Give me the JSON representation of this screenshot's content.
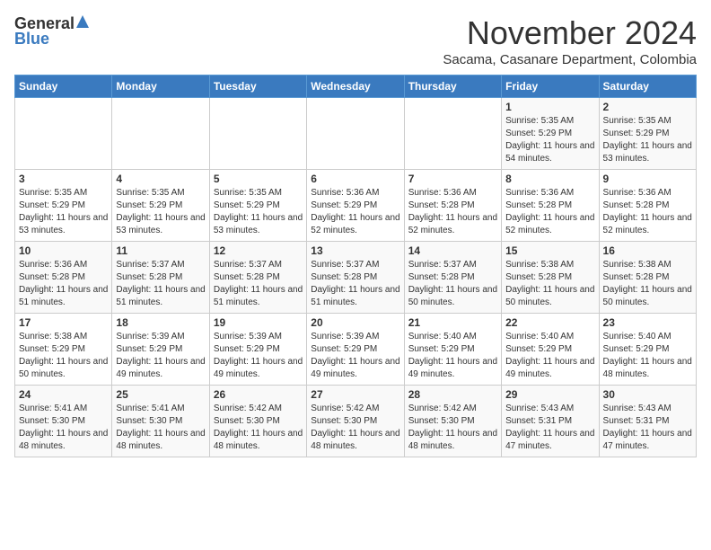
{
  "header": {
    "logo_general": "General",
    "logo_blue": "Blue",
    "month_year": "November 2024",
    "location": "Sacama, Casanare Department, Colombia"
  },
  "days_of_week": [
    "Sunday",
    "Monday",
    "Tuesday",
    "Wednesday",
    "Thursday",
    "Friday",
    "Saturday"
  ],
  "weeks": [
    [
      {
        "day": "",
        "info": ""
      },
      {
        "day": "",
        "info": ""
      },
      {
        "day": "",
        "info": ""
      },
      {
        "day": "",
        "info": ""
      },
      {
        "day": "",
        "info": ""
      },
      {
        "day": "1",
        "info": "Sunrise: 5:35 AM\nSunset: 5:29 PM\nDaylight: 11 hours and 54 minutes."
      },
      {
        "day": "2",
        "info": "Sunrise: 5:35 AM\nSunset: 5:29 PM\nDaylight: 11 hours and 53 minutes."
      }
    ],
    [
      {
        "day": "3",
        "info": "Sunrise: 5:35 AM\nSunset: 5:29 PM\nDaylight: 11 hours and 53 minutes."
      },
      {
        "day": "4",
        "info": "Sunrise: 5:35 AM\nSunset: 5:29 PM\nDaylight: 11 hours and 53 minutes."
      },
      {
        "day": "5",
        "info": "Sunrise: 5:35 AM\nSunset: 5:29 PM\nDaylight: 11 hours and 53 minutes."
      },
      {
        "day": "6",
        "info": "Sunrise: 5:36 AM\nSunset: 5:29 PM\nDaylight: 11 hours and 52 minutes."
      },
      {
        "day": "7",
        "info": "Sunrise: 5:36 AM\nSunset: 5:28 PM\nDaylight: 11 hours and 52 minutes."
      },
      {
        "day": "8",
        "info": "Sunrise: 5:36 AM\nSunset: 5:28 PM\nDaylight: 11 hours and 52 minutes."
      },
      {
        "day": "9",
        "info": "Sunrise: 5:36 AM\nSunset: 5:28 PM\nDaylight: 11 hours and 52 minutes."
      }
    ],
    [
      {
        "day": "10",
        "info": "Sunrise: 5:36 AM\nSunset: 5:28 PM\nDaylight: 11 hours and 51 minutes."
      },
      {
        "day": "11",
        "info": "Sunrise: 5:37 AM\nSunset: 5:28 PM\nDaylight: 11 hours and 51 minutes."
      },
      {
        "day": "12",
        "info": "Sunrise: 5:37 AM\nSunset: 5:28 PM\nDaylight: 11 hours and 51 minutes."
      },
      {
        "day": "13",
        "info": "Sunrise: 5:37 AM\nSunset: 5:28 PM\nDaylight: 11 hours and 51 minutes."
      },
      {
        "day": "14",
        "info": "Sunrise: 5:37 AM\nSunset: 5:28 PM\nDaylight: 11 hours and 50 minutes."
      },
      {
        "day": "15",
        "info": "Sunrise: 5:38 AM\nSunset: 5:28 PM\nDaylight: 11 hours and 50 minutes."
      },
      {
        "day": "16",
        "info": "Sunrise: 5:38 AM\nSunset: 5:28 PM\nDaylight: 11 hours and 50 minutes."
      }
    ],
    [
      {
        "day": "17",
        "info": "Sunrise: 5:38 AM\nSunset: 5:29 PM\nDaylight: 11 hours and 50 minutes."
      },
      {
        "day": "18",
        "info": "Sunrise: 5:39 AM\nSunset: 5:29 PM\nDaylight: 11 hours and 49 minutes."
      },
      {
        "day": "19",
        "info": "Sunrise: 5:39 AM\nSunset: 5:29 PM\nDaylight: 11 hours and 49 minutes."
      },
      {
        "day": "20",
        "info": "Sunrise: 5:39 AM\nSunset: 5:29 PM\nDaylight: 11 hours and 49 minutes."
      },
      {
        "day": "21",
        "info": "Sunrise: 5:40 AM\nSunset: 5:29 PM\nDaylight: 11 hours and 49 minutes."
      },
      {
        "day": "22",
        "info": "Sunrise: 5:40 AM\nSunset: 5:29 PM\nDaylight: 11 hours and 49 minutes."
      },
      {
        "day": "23",
        "info": "Sunrise: 5:40 AM\nSunset: 5:29 PM\nDaylight: 11 hours and 48 minutes."
      }
    ],
    [
      {
        "day": "24",
        "info": "Sunrise: 5:41 AM\nSunset: 5:30 PM\nDaylight: 11 hours and 48 minutes."
      },
      {
        "day": "25",
        "info": "Sunrise: 5:41 AM\nSunset: 5:30 PM\nDaylight: 11 hours and 48 minutes."
      },
      {
        "day": "26",
        "info": "Sunrise: 5:42 AM\nSunset: 5:30 PM\nDaylight: 11 hours and 48 minutes."
      },
      {
        "day": "27",
        "info": "Sunrise: 5:42 AM\nSunset: 5:30 PM\nDaylight: 11 hours and 48 minutes."
      },
      {
        "day": "28",
        "info": "Sunrise: 5:42 AM\nSunset: 5:30 PM\nDaylight: 11 hours and 48 minutes."
      },
      {
        "day": "29",
        "info": "Sunrise: 5:43 AM\nSunset: 5:31 PM\nDaylight: 11 hours and 47 minutes."
      },
      {
        "day": "30",
        "info": "Sunrise: 5:43 AM\nSunset: 5:31 PM\nDaylight: 11 hours and 47 minutes."
      }
    ]
  ]
}
